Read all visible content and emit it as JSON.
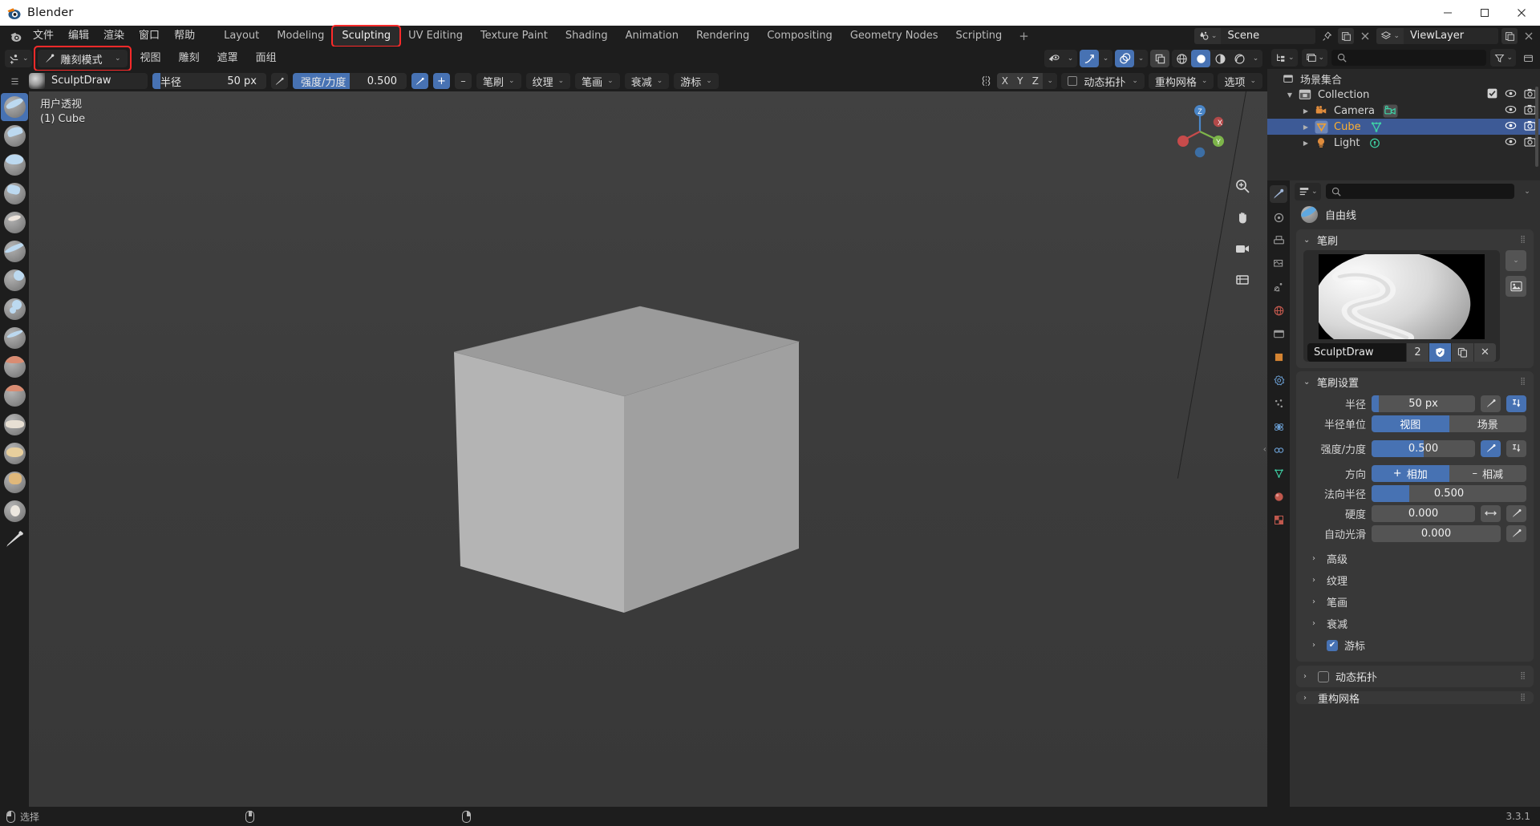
{
  "window": {
    "title": "Blender",
    "minimize": "–",
    "maximize": "▢",
    "close": "✕"
  },
  "topbar": {
    "menus": [
      "文件",
      "编辑",
      "渲染",
      "窗口",
      "帮助"
    ],
    "tabs": [
      {
        "label": "Layout",
        "state": "normal"
      },
      {
        "label": "Modeling",
        "state": "normal"
      },
      {
        "label": "Sculpting",
        "state": "highlighted"
      },
      {
        "label": "UV Editing",
        "state": "normal"
      },
      {
        "label": "Texture Paint",
        "state": "normal"
      },
      {
        "label": "Shading",
        "state": "normal"
      },
      {
        "label": "Animation",
        "state": "normal"
      },
      {
        "label": "Rendering",
        "state": "normal"
      },
      {
        "label": "Compositing",
        "state": "normal"
      },
      {
        "label": "Geometry Nodes",
        "state": "normal"
      },
      {
        "label": "Scripting",
        "state": "normal"
      }
    ],
    "add_tab": "+",
    "scene_name": "Scene",
    "view_layer_name": "ViewLayer"
  },
  "viewport_header": {
    "mode": "雕刻模式",
    "menus": [
      "视图",
      "雕刻",
      "遮罩",
      "面组"
    ]
  },
  "tool_settings": {
    "brush_name": "SculptDraw",
    "radius_label": "半径",
    "radius_value": "50 px",
    "strength_label": "强度/力度",
    "strength_value": "0.500",
    "plus": "+",
    "minus": "–",
    "dropdowns": [
      "笔刷",
      "纹理",
      "笔画",
      "衰减",
      "游标"
    ],
    "axes": [
      "X",
      "Y",
      "Z"
    ],
    "dyntopo": "动态拓扑",
    "remesh": "重构网格",
    "options": "选项"
  },
  "viewport": {
    "overlay_line1": "用户透视",
    "overlay_line2": "(1) Cube",
    "gizmo_axes": [
      "X",
      "Y",
      "Z"
    ]
  },
  "outliner": {
    "search_placeholder": "",
    "root": "场景集合",
    "items": [
      {
        "label": "Collection",
        "indent": 1,
        "type": "collection",
        "selected": false
      },
      {
        "label": "Camera",
        "indent": 2,
        "type": "camera",
        "selected": false
      },
      {
        "label": "Cube",
        "indent": 2,
        "type": "mesh",
        "selected": true
      },
      {
        "label": "Light",
        "indent": 2,
        "type": "light",
        "selected": false
      }
    ]
  },
  "properties": {
    "search_placeholder": "",
    "breadcrumb": "自由线",
    "brush_panel": {
      "title": "笔刷",
      "name": "SculptDraw",
      "users": "2",
      "fake_user_icon": "shield",
      "duplicate_icon": "copy",
      "delete_icon": "✕"
    },
    "brush_settings": {
      "title": "笔刷设置",
      "rows": [
        {
          "label": "半径",
          "value": "50 px",
          "fill": 0.07,
          "type": "slider"
        },
        {
          "label": "半径单位",
          "type": "segment",
          "options": [
            "视图",
            "场景"
          ],
          "selected": 0
        },
        {
          "label": "强度/力度",
          "value": "0.500",
          "fill": 0.5,
          "type": "slider"
        },
        {
          "label": "方向",
          "type": "segment",
          "options": [
            "相加",
            "相减"
          ],
          "selected": 0
        },
        {
          "label": "法向半径",
          "value": "0.500",
          "fill": 0.245,
          "type": "slider"
        },
        {
          "label": "硬度",
          "value": "0.000",
          "fill": 0,
          "type": "slider"
        },
        {
          "label": "自动光滑",
          "value": "0.000",
          "fill": 0,
          "type": "slider"
        }
      ],
      "subsections": [
        {
          "label": "高级",
          "checkbox": null
        },
        {
          "label": "纹理",
          "checkbox": null
        },
        {
          "label": "笔画",
          "checkbox": null
        },
        {
          "label": "衰减",
          "checkbox": null
        },
        {
          "label": "游标",
          "checkbox": true
        }
      ]
    },
    "sections": [
      {
        "label": "动态拓扑",
        "checkbox": false
      },
      {
        "label": "重构网格",
        "checkbox": null
      }
    ]
  },
  "statusbar": {
    "select_label": "选择",
    "version": "3.3.1"
  },
  "colors": {
    "accent": "#4772b3",
    "highlight_outline": "#ff2a2a",
    "panel_bg": "#383838",
    "editor_bg": "#303030",
    "outliner_bg": "#282828",
    "selected_row": "#3d5a96",
    "selected_text": "#ffb02e"
  }
}
